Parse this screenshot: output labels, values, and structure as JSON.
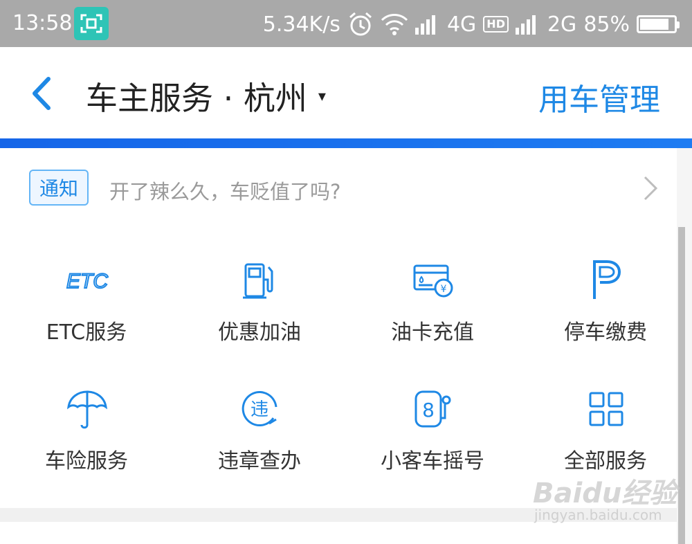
{
  "status_bar": {
    "time": "13:58",
    "speed": "5.34K/s",
    "network1": "4G",
    "hd": "HD",
    "network2": "2G",
    "battery": "85%",
    "battery_level": 0.85
  },
  "header": {
    "title": "车主服务 · 杭州",
    "dropdown_glyph": "▾",
    "right_action": "用车管理"
  },
  "notice": {
    "tag": "通知",
    "text": "开了辣么久，车贬值了吗?"
  },
  "services": [
    {
      "label": "ETC服务",
      "icon": "etc-icon"
    },
    {
      "label": "优惠加油",
      "icon": "fuel-pump-icon"
    },
    {
      "label": "油卡充值",
      "icon": "fuel-card-icon"
    },
    {
      "label": "停车缴费",
      "icon": "parking-icon"
    },
    {
      "label": "车险服务",
      "icon": "umbrella-icon"
    },
    {
      "label": "违章查办",
      "icon": "violation-icon"
    },
    {
      "label": "小客车摇号",
      "icon": "lottery-icon"
    },
    {
      "label": "全部服务",
      "icon": "grid-icon"
    }
  ],
  "watermark": {
    "main": "Baidu经验",
    "sub": "jingyan.baidu.com"
  },
  "colors": {
    "accent": "#1e88e5",
    "statusbar": "#a9a9a9",
    "scan_badge": "#2ec4b6"
  }
}
